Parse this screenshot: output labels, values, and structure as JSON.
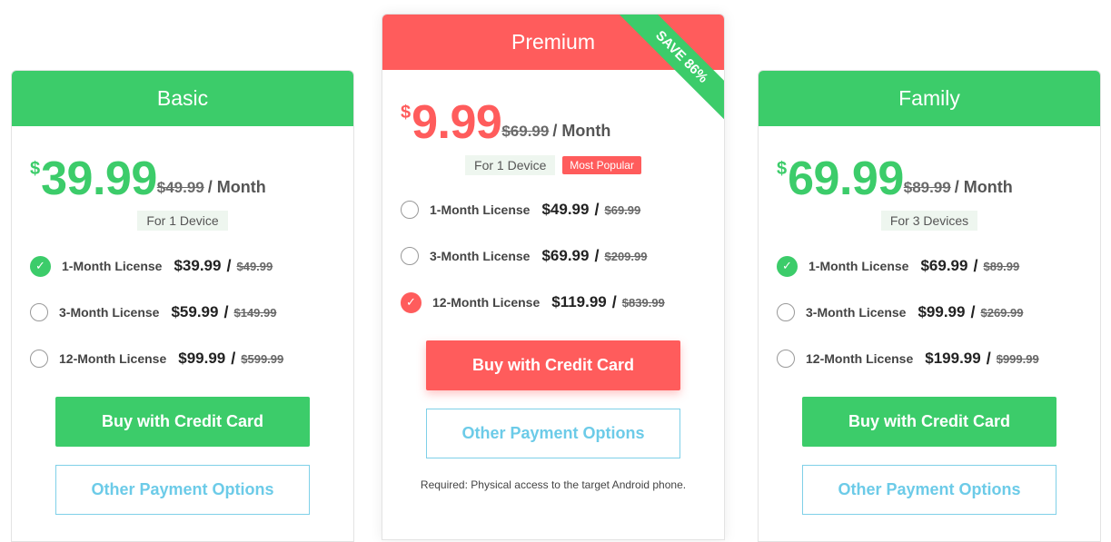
{
  "colors": {
    "green": "#3ccc6a",
    "red": "#ff5c5c",
    "outline_blue": "#6ccbe8"
  },
  "plans": {
    "basic": {
      "name": "Basic",
      "currency": "$",
      "price": "39.99",
      "old_price": "$49.99",
      "per": "/ Month",
      "devices": "For 1 Device",
      "options": [
        {
          "label": "1-Month License",
          "price": "$39.99",
          "slash": "/",
          "old_price": "$49.99",
          "checked": true
        },
        {
          "label": "3-Month License",
          "price": "$59.99",
          "slash": "/",
          "old_price": "$149.99",
          "checked": false
        },
        {
          "label": "12-Month License",
          "price": "$99.99",
          "slash": "/",
          "old_price": "$599.99",
          "checked": false
        }
      ],
      "buy_label": "Buy with Credit Card",
      "other_label": "Other Payment Options"
    },
    "premium": {
      "name": "Premium",
      "ribbon": "SAVE 86%",
      "currency": "$",
      "price": "9.99",
      "old_price": "$69.99",
      "per": "/ Month",
      "devices": "For 1 Device",
      "badge": "Most Popular",
      "options": [
        {
          "label": "1-Month License",
          "price": "$49.99",
          "slash": "/",
          "old_price": "$69.99",
          "checked": false
        },
        {
          "label": "3-Month License",
          "price": "$69.99",
          "slash": "/",
          "old_price": "$209.99",
          "checked": false
        },
        {
          "label": "12-Month License",
          "price": "$119.99",
          "slash": "/",
          "old_price": "$839.99",
          "checked": true
        }
      ],
      "buy_label": "Buy with Credit Card",
      "other_label": "Other Payment Options",
      "requirement": "Required: Physical access to the target Android phone."
    },
    "family": {
      "name": "Family",
      "currency": "$",
      "price": "69.99",
      "old_price": "$89.99",
      "per": "/ Month",
      "devices": "For 3 Devices",
      "options": [
        {
          "label": "1-Month License",
          "price": "$69.99",
          "slash": "/",
          "old_price": "$89.99",
          "checked": true
        },
        {
          "label": "3-Month License",
          "price": "$99.99",
          "slash": "/",
          "old_price": "$269.99",
          "checked": false
        },
        {
          "label": "12-Month License",
          "price": "$199.99",
          "slash": "/",
          "old_price": "$999.99",
          "checked": false
        }
      ],
      "buy_label": "Buy with Credit Card",
      "other_label": "Other Payment Options"
    }
  }
}
